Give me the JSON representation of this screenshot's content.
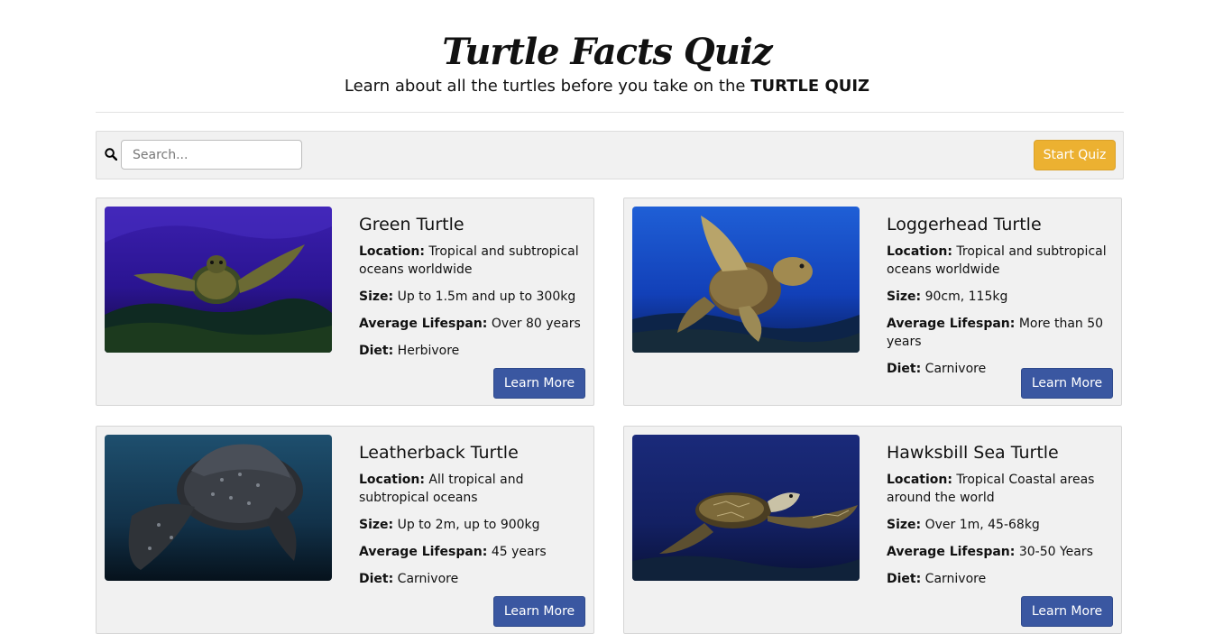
{
  "header": {
    "title": "Turtle Facts Quiz",
    "subtitle_prefix": "Learn about all the turtles before you take on the ",
    "subtitle_strong": "TURTLE QUIZ"
  },
  "toolbar": {
    "search_icon": "search-icon",
    "search_placeholder": "Search...",
    "search_value": "",
    "start_label": "Start Quiz",
    "start_color": "#ecb131"
  },
  "labels": {
    "location": "Location:",
    "size": "Size:",
    "lifespan": "Average Lifespan:",
    "diet": "Diet:",
    "learn_more": "Learn More"
  },
  "colors": {
    "learn_more": "#3a57a1",
    "card_bg": "#f1f1f1"
  },
  "turtles": [
    {
      "name": "Green Turtle",
      "location": "Tropical and subtropical oceans worldwide",
      "size": "Up to 1.5m and up to 300kg",
      "lifespan": "Over 80 years",
      "diet": "Herbivore"
    },
    {
      "name": "Loggerhead Turtle",
      "location": "Tropical and subtropical oceans worldwide",
      "size": "90cm, 115kg",
      "lifespan": "More than 50 years",
      "diet": "Carnivore"
    },
    {
      "name": "Leatherback Turtle",
      "location": "All tropical and subtropical oceans",
      "size": "Up to 2m, up to 900kg",
      "lifespan": "45 years",
      "diet": "Carnivore"
    },
    {
      "name": "Hawksbill Sea Turtle",
      "location": "Tropical Coastal areas around the world",
      "size": "Over 1m, 45-68kg",
      "lifespan": "30-50 Years",
      "diet": "Carnivore"
    }
  ]
}
